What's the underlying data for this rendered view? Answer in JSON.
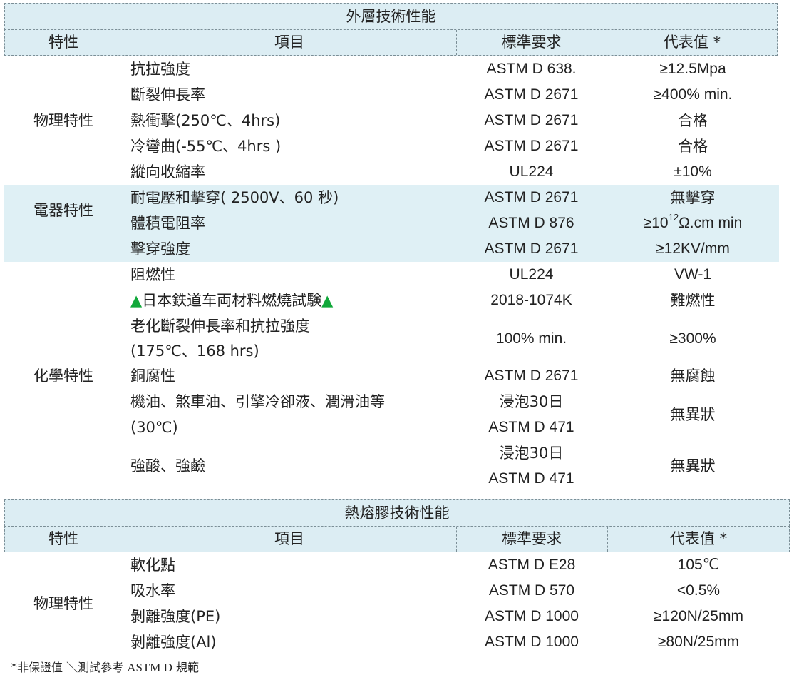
{
  "table1": {
    "title": "外層技術性能",
    "headers": {
      "feature": "特性",
      "item": "項目",
      "standard": "標準要求",
      "value": "代表值",
      "value_mark": "*"
    },
    "groups": {
      "physical": "物理特性",
      "electrical": "電器特性",
      "chemical": "化學特性"
    },
    "rows": [
      {
        "item": "抗拉強度",
        "standard": "ASTM D 638.",
        "value": "≥12.5Mpa"
      },
      {
        "item": "斷裂伸長率",
        "standard": "ASTM D 2671",
        "value": "≥400% min."
      },
      {
        "item": "熱衝擊(250℃、4hrs)",
        "standard": "ASTM D 2671",
        "value": "合格"
      },
      {
        "item": "冷彎曲(-55℃、4hrs )",
        "standard": "ASTM D 2671",
        "value": "合格"
      },
      {
        "item": "縱向收縮率",
        "standard": "UL224",
        "value": "±10%"
      },
      {
        "item": "耐電壓和擊穿( 2500V、60  秒)",
        "standard": "ASTM D 2671",
        "value": "無擊穿"
      },
      {
        "item": "體積電阻率",
        "standard": "ASTM D 876",
        "value_pre": "≥10",
        "value_sup": "12",
        "value_post": "Ω.cm min"
      },
      {
        "item": "擊穿強度",
        "standard": "ASTM D 2671",
        "value": "≥12KV/mm"
      },
      {
        "item": "阻燃性",
        "standard": "UL224",
        "value": "VW-1"
      },
      {
        "item_pre": "▲",
        "item": "日本鉄道车両材料燃燒試験",
        "item_post": "▲",
        "standard": "2018-1074K",
        "value": "難燃性"
      },
      {
        "item_line1": "老化斷裂伸長率和抗拉強度",
        "item_line2": "(175℃、168 hrs)",
        "standard": "100% min.",
        "value": "≥300%"
      },
      {
        "item": "銅腐性",
        "standard": "ASTM D 2671",
        "value": "無腐蝕"
      },
      {
        "item_line1": "機油、煞車油、引擎冷卻液、潤滑油等",
        "item_line2": "(30℃)",
        "standard_line1": "浸泡30日",
        "standard_line2": "ASTM D 471",
        "value": "無異狀"
      },
      {
        "item": "強酸、強鹼",
        "standard_line1": "浸泡30日",
        "standard_line2": "ASTM D 471",
        "value": "無異狀"
      }
    ]
  },
  "table2": {
    "title": "熱熔膠技術性能",
    "headers": {
      "feature": "特性",
      "item": "項目",
      "standard": "標準要求",
      "value": "代表值",
      "value_mark": "*"
    },
    "group": "物理特性",
    "rows": [
      {
        "item": "軟化點",
        "standard": "ASTM D E28",
        "value": "105℃"
      },
      {
        "item": "吸水率",
        "standard": "ASTM D 570",
        "value": "<0.5%"
      },
      {
        "item": "剝離強度(PE)",
        "standard": "ASTM D 1000",
        "value": "≥120N/25mm"
      },
      {
        "item": "剝離強度(Al)",
        "standard": "ASTM D 1000",
        "value": "≥80N/25mm"
      }
    ]
  },
  "footnote": {
    "star": "*",
    "text": "非保證值 ＼測試參考 ",
    "en": "ASTM D",
    "tail": " 規範"
  },
  "colors": {
    "header_bg": "#dcedf3",
    "band_bg": "#dff0f5",
    "triangle": "#11a83a",
    "dash": "#7b8e96"
  }
}
